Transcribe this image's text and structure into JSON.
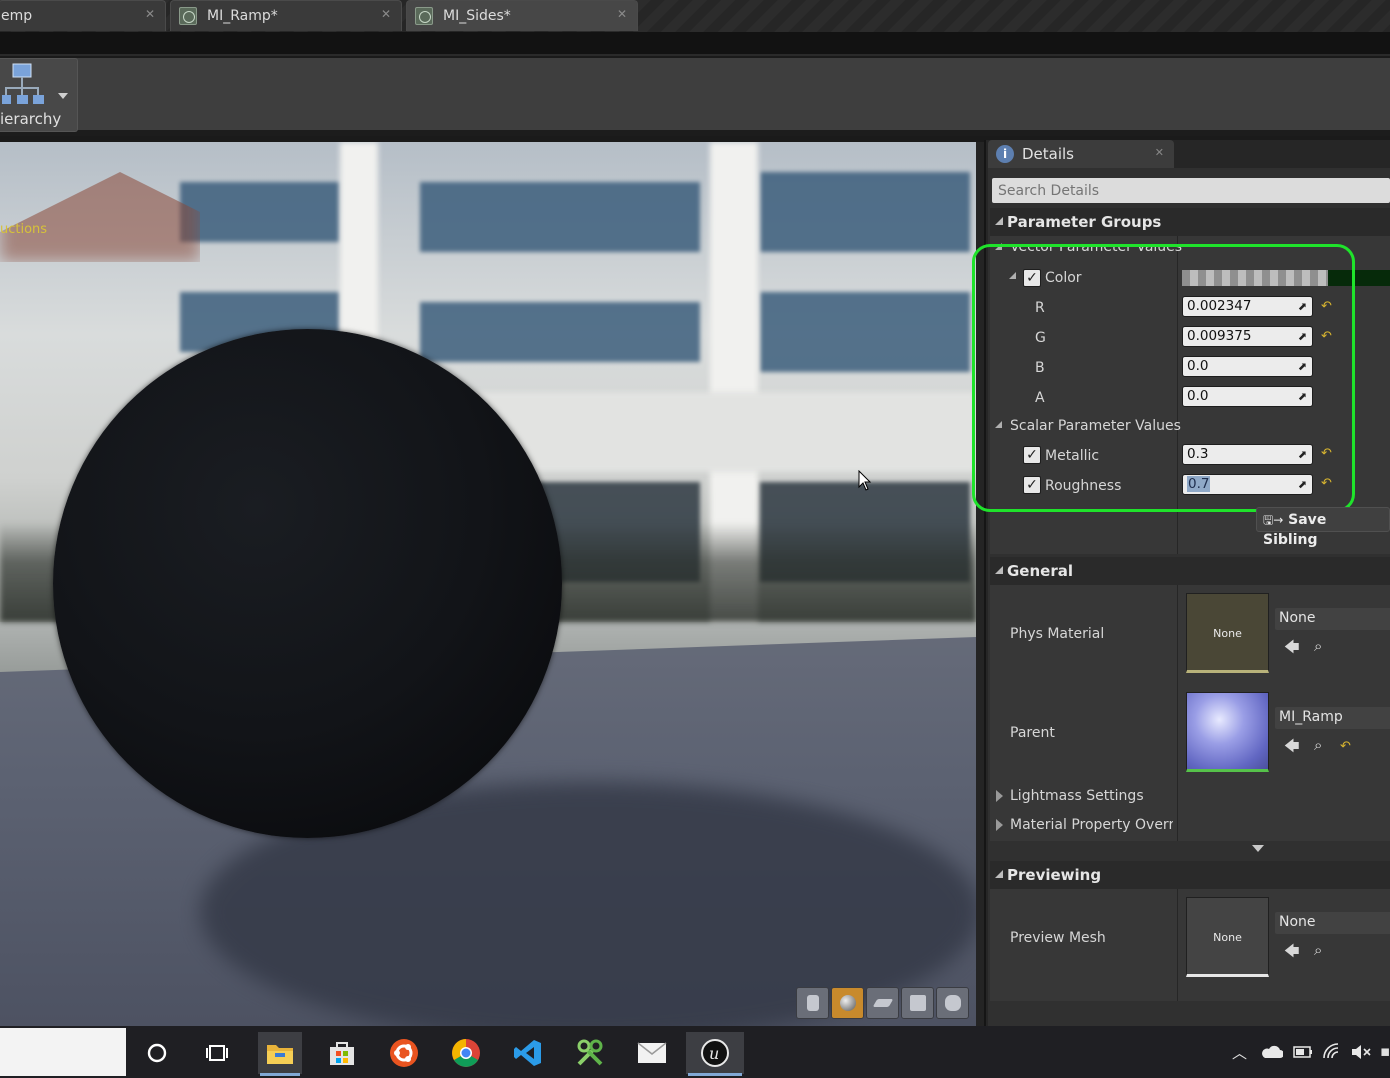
{
  "tabs": [
    {
      "label": "emp"
    },
    {
      "label": "MI_Ramp*"
    },
    {
      "label": "MI_Sides*"
    }
  ],
  "toolbar": {
    "hierarchy_label": "ierarchy"
  },
  "viewport": {
    "instructions_text": "uctions"
  },
  "details": {
    "tab_title": "Details",
    "search_placeholder": "Search Details",
    "parameter_groups": {
      "title": "Parameter Groups",
      "vector_group": "Vector Parameter Values",
      "color_label": "Color",
      "components": [
        {
          "label": "R",
          "value": "0.002347",
          "reset": true
        },
        {
          "label": "G",
          "value": "0.009375",
          "reset": true
        },
        {
          "label": "B",
          "value": "0.0",
          "reset": false
        },
        {
          "label": "A",
          "value": "0.0",
          "reset": false
        }
      ],
      "scalar_group": "Scalar Parameter Values",
      "metallic_label": "Metallic",
      "metallic_value": "0.3",
      "roughness_label": "Roughness",
      "roughness_value": "0.7",
      "save_button": "Save Sibling"
    },
    "general": {
      "title": "General",
      "phys_material_label": "Phys Material",
      "phys_material_thumb": "None",
      "phys_material_value": "None",
      "parent_label": "Parent",
      "parent_value": "MI_Ramp",
      "lightmass_label": "Lightmass Settings",
      "material_property_label": "Material Property Overric"
    },
    "previewing": {
      "title": "Previewing",
      "preview_mesh_label": "Preview Mesh",
      "preview_mesh_thumb": "None",
      "preview_mesh_value": "None"
    }
  },
  "colors": {
    "highlight": "#1fe32b",
    "reset_arrow": "#d8b530",
    "active_view_button": "#c88a2c",
    "instructions_text": "#d6c23a"
  },
  "taskbar": {
    "icons": [
      "cortana-icon",
      "task-view-icon",
      "file-explorer-icon",
      "store-icon",
      "ubuntu-icon",
      "chrome-icon",
      "vscode-icon",
      "tool-icon",
      "mail-icon",
      "unreal-engine-icon"
    ]
  }
}
